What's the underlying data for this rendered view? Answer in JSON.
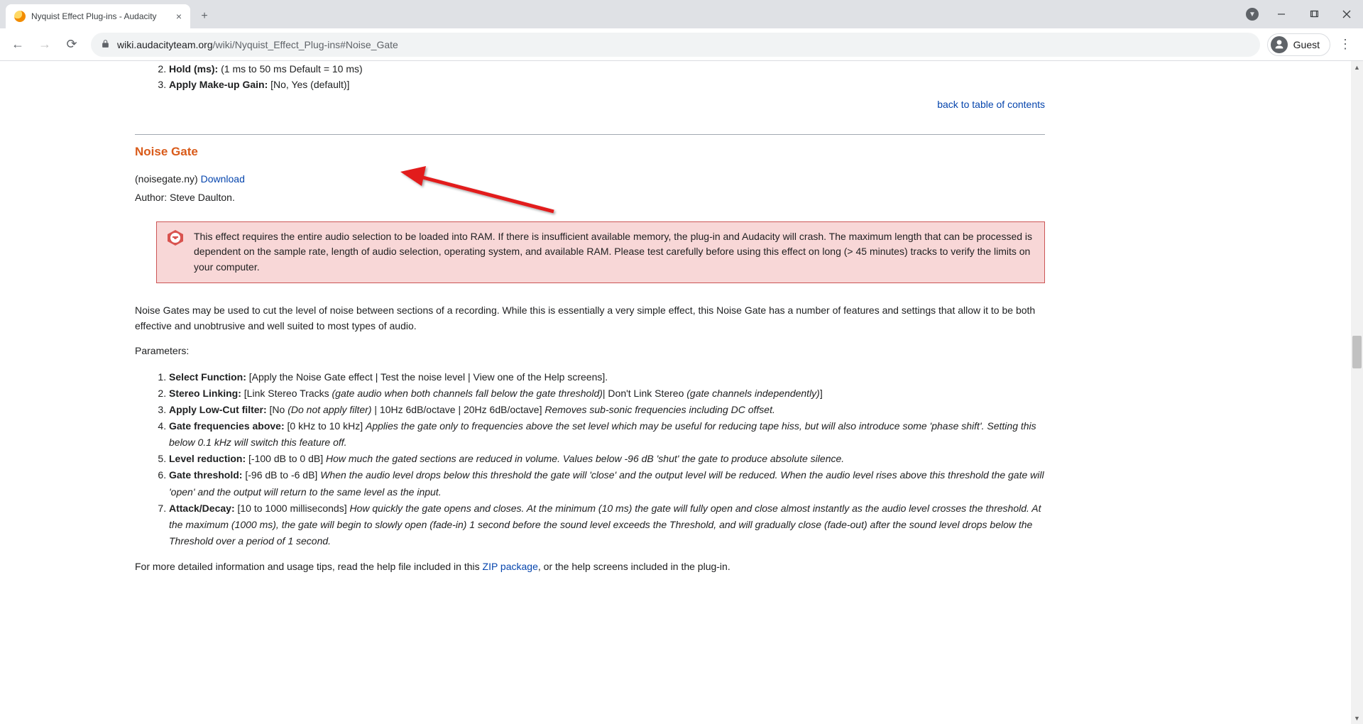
{
  "browser": {
    "tab_title": "Nyquist Effect Plug-ins - Audacity",
    "url_host": "wiki.audacityteam.org",
    "url_path": "/wiki/Nyquist_Effect_Plug-ins#Noise_Gate",
    "guest_label": "Guest"
  },
  "prev_params": {
    "start_index": 2,
    "items": [
      {
        "label": "Hold (ms):",
        "value": "(1 ms to 50 ms Default = 10 ms)"
      },
      {
        "label": "Apply Make-up Gain:",
        "value": "[No, Yes (default)]"
      }
    ]
  },
  "toc_link": "back to table of contents",
  "section": {
    "title": "Noise Gate",
    "filename": "(noisegate.ny) ",
    "download": "Download",
    "author": "Author: Steve Daulton."
  },
  "warning": "This effect requires the entire audio selection to be loaded into RAM. If there is insufficient available memory, the plug-in and Audacity will crash. The maximum length that can be processed is dependent on the sample rate, length of audio selection, operating system, and available RAM. Please test carefully before using this effect on long (> 45 minutes) tracks to verify the limits on your computer.",
  "intro": "Noise Gates may be used to cut the level of noise between sections of a recording. While this is essentially a very simple effect, this Noise Gate has a number of features and settings that allow it to be both effective and unobtrusive and well suited to most types of audio.",
  "params_heading": "Parameters:",
  "params": [
    {
      "name": "Select Function:",
      "range": "[Apply the Noise Gate effect | Test the noise level | View one of the Help screens].",
      "desc": ""
    },
    {
      "name": "Stereo Linking:",
      "range": "[Link Stereo Tracks ",
      "desc_a": "(gate audio when both channels fall below the gate threshold)",
      "mid": "| Don't Link Stereo ",
      "desc_b": "(gate channels independently)",
      "tail": "]"
    },
    {
      "name": "Apply Low-Cut filter:",
      "range": "[No ",
      "desc_a": "(Do not apply filter)",
      "mid": " | 10Hz 6dB/octave | 20Hz 6dB/octave] ",
      "desc_b": "Removes sub-sonic frequencies including DC offset.",
      "tail": ""
    },
    {
      "name": "Gate frequencies above:",
      "range": "[0 kHz to 10 kHz] ",
      "desc": "Applies the gate only to frequencies above the set level which may be useful for reducing tape hiss, but will also introduce some 'phase shift'. Setting this below 0.1 kHz will switch this feature off."
    },
    {
      "name": "Level reduction:",
      "range": "[-100 dB to 0 dB] ",
      "desc": "How much the gated sections are reduced in volume. Values below -96 dB 'shut' the gate to produce absolute silence."
    },
    {
      "name": "Gate threshold:",
      "range": "[-96 dB to -6 dB] ",
      "desc": "When the audio level drops below this threshold the gate will 'close' and the output level will be reduced. When the audio level rises above this threshold the gate will 'open' and the output will return to the same level as the input."
    },
    {
      "name": "Attack/Decay:",
      "range": "[10 to 1000 milliseconds] ",
      "desc": "How quickly the gate opens and closes. At the minimum (10 ms) the gate will fully open and close almost instantly as the audio level crosses the threshold. At the maximum (1000 ms), the gate will begin to slowly open (fade-in) 1 second before the sound level exceeds the Threshold, and will gradually close (fade-out) after the sound level drops below the Threshold over a period of 1 second."
    }
  ],
  "footer": {
    "pre": "For more detailed information and usage tips, read the help file included in this ",
    "link": "ZIP package",
    "post": ", or the help screens included in the plug-in."
  }
}
